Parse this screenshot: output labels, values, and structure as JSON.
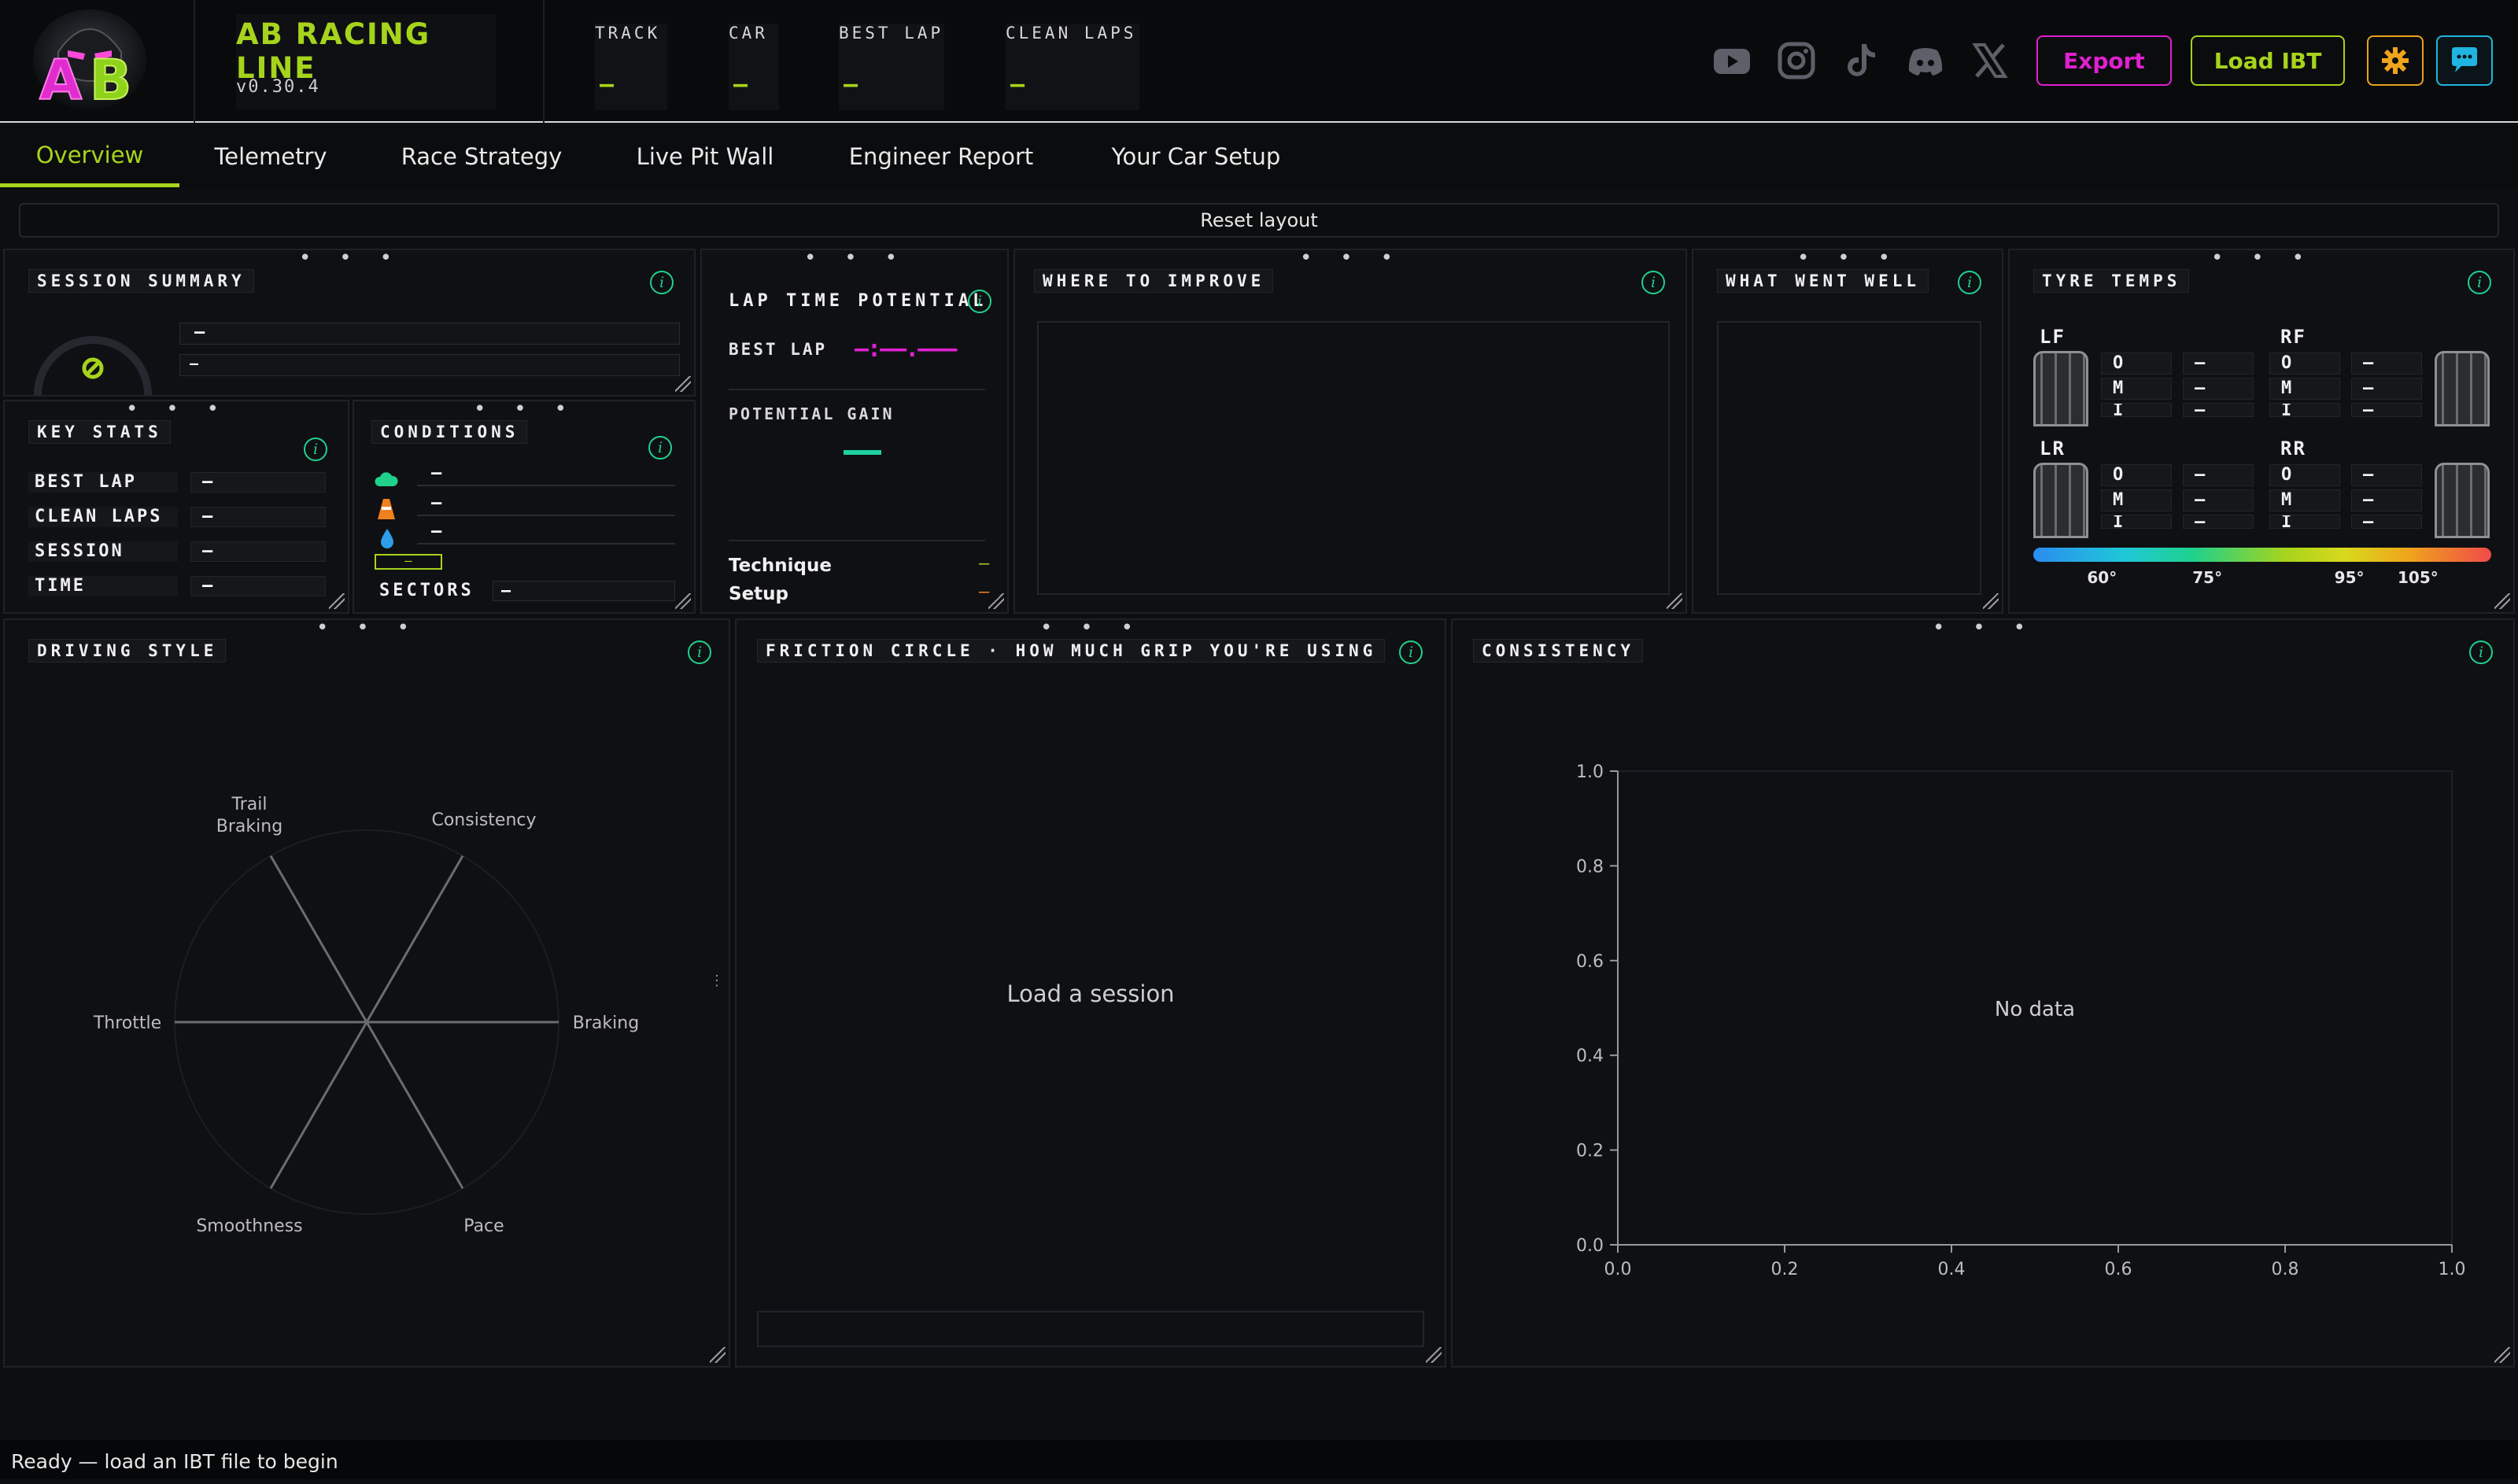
{
  "app": {
    "title": "AB RACING LINE",
    "version": "v0.30.4",
    "logo_text": "AB"
  },
  "header_stats": [
    {
      "label": "TRACK",
      "value": "—"
    },
    {
      "label": "CAR",
      "value": "—"
    },
    {
      "label": "BEST LAP",
      "value": "—"
    },
    {
      "label": "CLEAN LAPS",
      "value": "—"
    }
  ],
  "social_icons": [
    "youtube-icon",
    "instagram-icon",
    "tiktok-icon",
    "discord-icon",
    "x-icon"
  ],
  "buttons": {
    "export": "Export",
    "load_ibt": "Load IBT"
  },
  "tabs": [
    "Overview",
    "Telemetry",
    "Race Strategy",
    "Live Pit Wall",
    "Engineer Report",
    "Your Car Setup"
  ],
  "active_tab": "Overview",
  "reset_layout": "Reset layout",
  "dots": "• • •",
  "session_summary": {
    "title": "SESSION SUMMARY",
    "row1": "—",
    "row2": "—"
  },
  "key_stats": {
    "title": "KEY STATS",
    "rows": [
      {
        "label": "BEST LAP",
        "value": "—"
      },
      {
        "label": "CLEAN LAPS",
        "value": "—"
      },
      {
        "label": "SESSION",
        "value": "—"
      },
      {
        "label": "TIME",
        "value": "—"
      }
    ]
  },
  "conditions": {
    "title": "CONDITIONS",
    "rows": [
      "—",
      "—",
      "—"
    ],
    "badge": "—",
    "sectors_label": "SECTORS",
    "sectors_value": "—"
  },
  "lap_time_potential": {
    "title": "LAP TIME POTENTIAL",
    "best_lap_label": "BEST LAP",
    "best_lap_value": "—:——.———",
    "potential_gain_label": "POTENTIAL GAIN",
    "potential_gain_value": "—",
    "technique_label": "Technique",
    "technique_value": "—",
    "setup_label": "Setup",
    "setup_value": "—"
  },
  "where_to_improve": {
    "title": "WHERE TO IMPROVE"
  },
  "what_went_well": {
    "title": "WHAT WENT WELL"
  },
  "tyre_temps": {
    "title": "TYRE TEMPS",
    "tyres": [
      {
        "name": "LF",
        "o": "—",
        "m": "—",
        "i": "—"
      },
      {
        "name": "RF",
        "o": "—",
        "m": "—",
        "i": "—"
      },
      {
        "name": "LR",
        "o": "—",
        "m": "—",
        "i": "—"
      },
      {
        "name": "RR",
        "o": "—",
        "m": "—",
        "i": "—"
      }
    ],
    "row_labels": [
      "O",
      "M",
      "I"
    ],
    "scale": [
      {
        "label": "60°",
        "pos": 0.15
      },
      {
        "label": "75°",
        "pos": 0.38
      },
      {
        "label": "95°",
        "pos": 0.69
      },
      {
        "label": "105°",
        "pos": 0.84
      }
    ]
  },
  "driving_style": {
    "title": "DRIVING STYLE",
    "axes": [
      {
        "label": "Consistency",
        "angle": -60
      },
      {
        "label": "Braking",
        "angle": 0
      },
      {
        "label": "Pace",
        "angle": 60
      },
      {
        "label": "Smoothness",
        "angle": 120
      },
      {
        "label": "Throttle",
        "angle": 180
      },
      {
        "label": "Trail",
        "label2": "Braking",
        "angle": 240
      }
    ]
  },
  "friction_circle": {
    "title": "FRICTION CIRCLE · HOW MUCH GRIP YOU'RE USING",
    "message": "Load a session"
  },
  "chart_data": {
    "type": "line",
    "title": "CONSISTENCY",
    "x": [],
    "values": [],
    "xlim": [
      0,
      1
    ],
    "ylim": [
      0,
      1
    ],
    "xticks": [
      "0.0",
      "0.2",
      "0.4",
      "0.6",
      "0.8",
      "1.0"
    ],
    "yticks": [
      "0.0",
      "0.2",
      "0.4",
      "0.6",
      "0.8",
      "1.0"
    ],
    "message": "No data",
    "grid": false
  },
  "status": "Ready — load an IBT file to begin",
  "colors": {
    "accent": "#a6d41c",
    "export": "#e020d0",
    "info": "#1fd18b",
    "settings": "#e8a21c",
    "chat": "#1fb5e0"
  }
}
